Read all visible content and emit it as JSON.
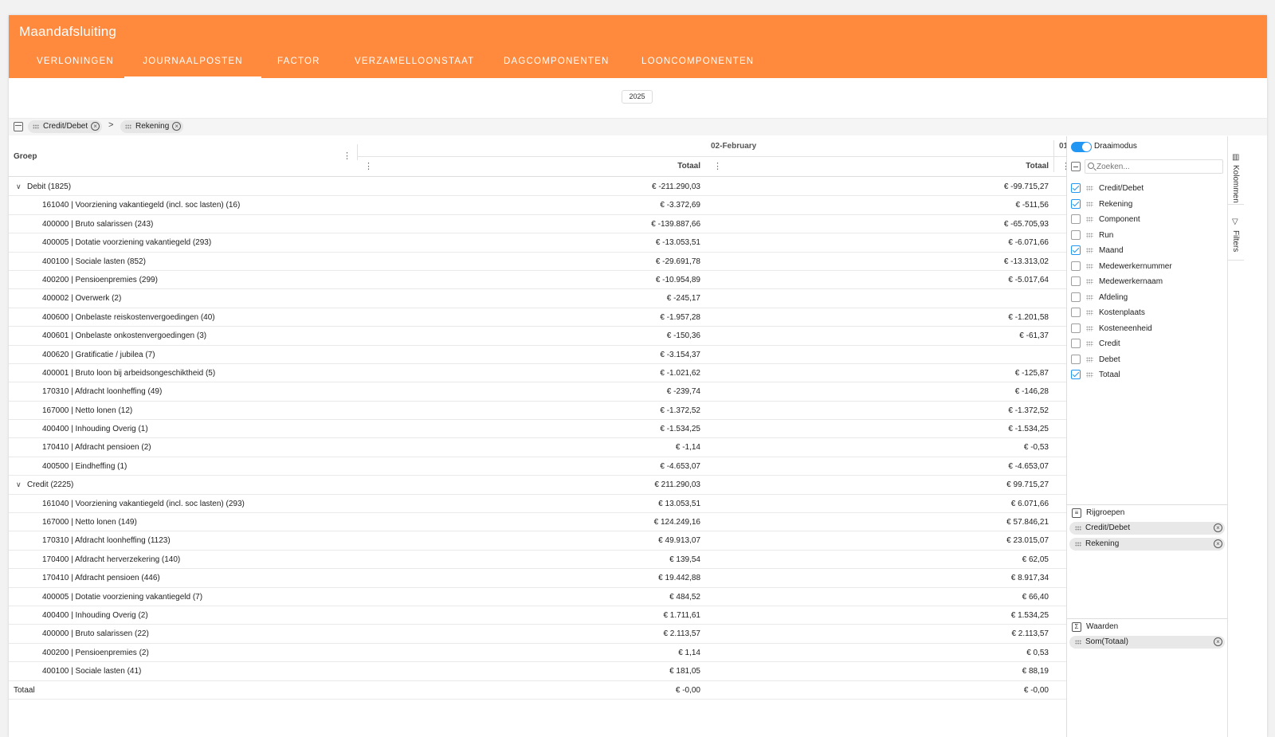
{
  "app": {
    "title": "Maandafsluiting"
  },
  "tabs": [
    {
      "label": "VERLONINGEN",
      "active": false
    },
    {
      "label": "JOURNAALPOSTEN",
      "active": true
    },
    {
      "label": "FACTOR",
      "active": false
    },
    {
      "label": "VERZAMELLOONSTAAT",
      "active": false
    },
    {
      "label": "DAGCOMPONENTEN",
      "active": false
    },
    {
      "label": "LOONCOMPONENTEN",
      "active": false
    }
  ],
  "year": "2025",
  "row_groups_bar": {
    "chips": [
      "Credit/Debet",
      "Rekening"
    ],
    "separator": ">"
  },
  "grid": {
    "group_header": "Groep",
    "month1": "02-February",
    "month2": "01",
    "value_header": "Totaal",
    "rows": [
      {
        "type": "group",
        "label": "Debit (1825)",
        "v1": "€ -211.290,03",
        "v2": "€ -99.715,27"
      },
      {
        "type": "item",
        "label": "161040 | Voorziening vakantiegeld (incl. soc lasten) (16)",
        "v1": "€ -3.372,69",
        "v2": "€ -511,56"
      },
      {
        "type": "item",
        "label": "400000 | Bruto salarissen (243)",
        "v1": "€ -139.887,66",
        "v2": "€ -65.705,93"
      },
      {
        "type": "item",
        "label": "400005 | Dotatie voorziening vakantiegeld (293)",
        "v1": "€ -13.053,51",
        "v2": "€ -6.071,66"
      },
      {
        "type": "item",
        "label": "400100 | Sociale lasten (852)",
        "v1": "€ -29.691,78",
        "v2": "€ -13.313,02"
      },
      {
        "type": "item",
        "label": "400200 | Pensioenpremies (299)",
        "v1": "€ -10.954,89",
        "v2": "€ -5.017,64"
      },
      {
        "type": "item",
        "label": "400002 | Overwerk (2)",
        "v1": "€ -245,17",
        "v2": ""
      },
      {
        "type": "item",
        "label": "400600 | Onbelaste reiskostenvergoedingen (40)",
        "v1": "€ -1.957,28",
        "v2": "€ -1.201,58"
      },
      {
        "type": "item",
        "label": "400601 | Onbelaste onkostenvergoedingen (3)",
        "v1": "€ -150,36",
        "v2": "€ -61,37"
      },
      {
        "type": "item",
        "label": "400620 | Gratificatie / jubilea (7)",
        "v1": "€ -3.154,37",
        "v2": ""
      },
      {
        "type": "item",
        "label": "400001 | Bruto loon bij arbeidsongeschiktheid (5)",
        "v1": "€ -1.021,62",
        "v2": "€ -125,87"
      },
      {
        "type": "item",
        "label": "170310 | Afdracht loonheffing (49)",
        "v1": "€ -239,74",
        "v2": "€ -146,28"
      },
      {
        "type": "item",
        "label": "167000 | Netto lonen (12)",
        "v1": "€ -1.372,52",
        "v2": "€ -1.372,52"
      },
      {
        "type": "item",
        "label": "400400 | Inhouding Overig (1)",
        "v1": "€ -1.534,25",
        "v2": "€ -1.534,25"
      },
      {
        "type": "item",
        "label": "170410 | Afdracht pensioen (2)",
        "v1": "€ -1,14",
        "v2": "€ -0,53"
      },
      {
        "type": "item",
        "label": "400500 | Eindheffing (1)",
        "v1": "€ -4.653,07",
        "v2": "€ -4.653,07"
      },
      {
        "type": "group",
        "label": "Credit (2225)",
        "v1": "€ 211.290,03",
        "v2": "€ 99.715,27"
      },
      {
        "type": "item",
        "label": "161040 | Voorziening vakantiegeld (incl. soc lasten) (293)",
        "v1": "€ 13.053,51",
        "v2": "€ 6.071,66"
      },
      {
        "type": "item",
        "label": "167000 | Netto lonen (149)",
        "v1": "€ 124.249,16",
        "v2": "€ 57.846,21"
      },
      {
        "type": "item",
        "label": "170310 | Afdracht loonheffing (1123)",
        "v1": "€ 49.913,07",
        "v2": "€ 23.015,07"
      },
      {
        "type": "item",
        "label": "170400 | Afdracht herverzekering (140)",
        "v1": "€ 139,54",
        "v2": "€ 62,05"
      },
      {
        "type": "item",
        "label": "170410 | Afdracht pensioen (446)",
        "v1": "€ 19.442,88",
        "v2": "€ 8.917,34"
      },
      {
        "type": "item",
        "label": "400005 | Dotatie voorziening vakantiegeld (7)",
        "v1": "€ 484,52",
        "v2": "€ 66,40"
      },
      {
        "type": "item",
        "label": "400400 | Inhouding Overig (2)",
        "v1": "€ 1.711,61",
        "v2": "€ 1.534,25"
      },
      {
        "type": "item",
        "label": "400000 | Bruto salarissen (22)",
        "v1": "€ 2.113,57",
        "v2": "€ 2.113,57"
      },
      {
        "type": "item",
        "label": "400200 | Pensioenpremies (2)",
        "v1": "€ 1,14",
        "v2": "€ 0,53"
      },
      {
        "type": "item",
        "label": "400100 | Sociale lasten (41)",
        "v1": "€ 181,05",
        "v2": "€ 88,19"
      },
      {
        "type": "total",
        "label": "Totaal",
        "v1": "€ -0,00",
        "v2": "€ -0,00"
      }
    ]
  },
  "sidebar": {
    "pivot_label": "Draaimodus",
    "pivot_on": true,
    "search_placeholder": "Zoeken...",
    "columns": [
      {
        "label": "Credit/Debet",
        "checked": true
      },
      {
        "label": "Rekening",
        "checked": true
      },
      {
        "label": "Component",
        "checked": false
      },
      {
        "label": "Run",
        "checked": false
      },
      {
        "label": "Maand",
        "checked": true
      },
      {
        "label": "Medewerkernummer",
        "checked": false
      },
      {
        "label": "Medewerkernaam",
        "checked": false
      },
      {
        "label": "Afdeling",
        "checked": false
      },
      {
        "label": "Kostenplaats",
        "checked": false
      },
      {
        "label": "Kosteneenheid",
        "checked": false
      },
      {
        "label": "Credit",
        "checked": false
      },
      {
        "label": "Debet",
        "checked": false
      },
      {
        "label": "Totaal",
        "checked": true
      }
    ],
    "row_groups_title": "Rijgroepen",
    "row_groups": [
      "Credit/Debet",
      "Rekening"
    ],
    "values_title": "Waarden",
    "values": [
      "Som(Totaal)"
    ]
  },
  "rail": {
    "columns_tab": "Kolommen",
    "filters_tab": "Filters"
  },
  "icons": {
    "chip_remove": "close-circle-icon",
    "group_caret": "chevron-down-icon",
    "menu": "vertical-dots-icon",
    "accent": "#ff8a3d",
    "toggle_color": "#2196f3"
  }
}
